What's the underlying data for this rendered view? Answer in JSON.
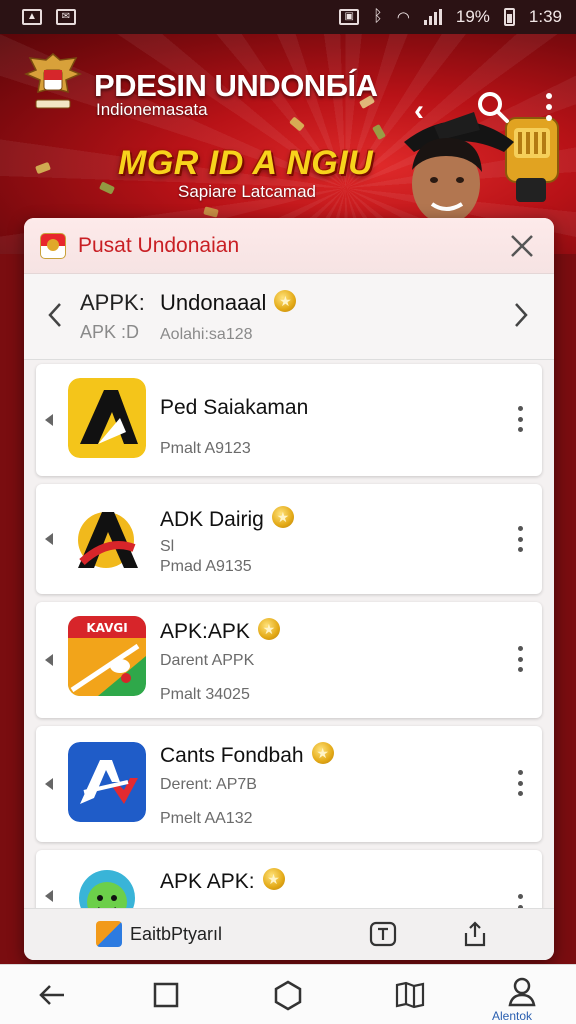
{
  "status_bar": {
    "battery": "19%",
    "time": "1:39"
  },
  "banner": {
    "title": "PDESIN UNDONБÍA",
    "subtitle": "Indionemasata",
    "headline": "MGR ID A NGIU",
    "tagline": "Sapiare Latcamad"
  },
  "panel": {
    "title": "Pusat Undonaian",
    "featured": {
      "code": "APPK:",
      "code_sub": "APK :D",
      "name": "Undonaaal",
      "subtitle": "Aolahi:sa128"
    },
    "apps": [
      {
        "name": "Ped Saiakaman",
        "lines": [
          "Pmalt A9123"
        ],
        "star": false,
        "icon": "black-a-yellow-icon"
      },
      {
        "name": "ADK Dairig",
        "lines": [
          "Sl",
          "Pmad A9135"
        ],
        "star": true,
        "icon": "red-a-circle-icon"
      },
      {
        "name": "APK:APK",
        "lines": [
          "Darent APPK",
          "Pmalt 34025"
        ],
        "star": true,
        "icon": "kavgi-map-icon"
      },
      {
        "name": "Cants Fondbah",
        "lines": [
          "Derent: AP7B",
          "Pmelt AA132"
        ],
        "star": true,
        "icon": "blue-av-icon"
      },
      {
        "name": "APK APK:",
        "lines": [],
        "star": true,
        "icon": "green-face-icon"
      }
    ],
    "footer": {
      "app_label": "EaitbPtyarıl"
    }
  },
  "nav_bar": {
    "account_label": "Alentok"
  },
  "colors": {
    "brand_red": "#c91f24",
    "banner_red": "#b81217",
    "headline_yellow": "#f7d31c",
    "star_gold": "#e3a916",
    "nav_label_blue": "#2a5fb0"
  }
}
